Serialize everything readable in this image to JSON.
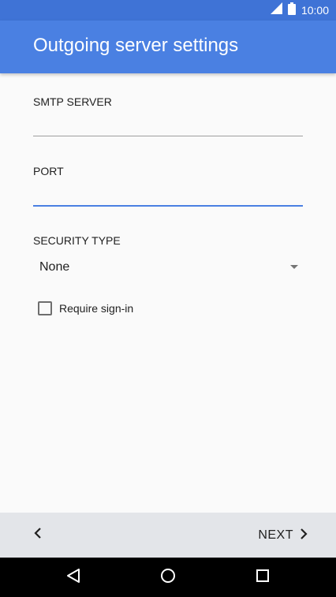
{
  "status_bar": {
    "time": "10:00",
    "icons": [
      "signal-icon",
      "battery-icon"
    ]
  },
  "header": {
    "title": "Outgoing server settings"
  },
  "form": {
    "smtp_server": {
      "label": "SMTP SERVER",
      "value": ""
    },
    "port": {
      "label": "PORT",
      "value": ""
    },
    "security_type": {
      "label": "SECURITY TYPE",
      "selected": "None"
    },
    "require_signin": {
      "label": "Require sign-in",
      "checked": false
    }
  },
  "bottom_bar": {
    "next_label": "NEXT"
  },
  "nav_bar": {
    "icons": [
      "back-icon",
      "home-icon",
      "recents-icon"
    ]
  },
  "colors": {
    "app_bar": "#4a80e2",
    "status_bar": "#3f73d6",
    "accent_underline": "#4a80e2",
    "background": "#fafafa"
  }
}
